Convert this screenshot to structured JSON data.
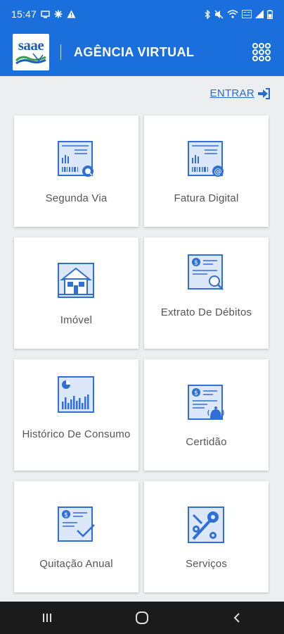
{
  "status_bar": {
    "time": "15:47"
  },
  "header": {
    "logo_text": "saae",
    "title": "AGÊNCIA VIRTUAL",
    "menu_icon": "apps-grid-icon"
  },
  "login": {
    "label": "ENTRAR",
    "icon": "login-arrow-icon"
  },
  "tiles": [
    {
      "label": "Segunda Via",
      "icon": "bill-barcode-icon"
    },
    {
      "label": "Fatura Digital",
      "icon": "digital-invoice-icon"
    },
    {
      "label": "Imóvel",
      "icon": "house-icon"
    },
    {
      "label": "Extrato De Débitos",
      "icon": "debt-statement-icon"
    },
    {
      "label": "Histórico De Consumo",
      "icon": "consumption-chart-icon"
    },
    {
      "label": "Certidão",
      "icon": "certificate-icon"
    },
    {
      "label": "Quitação Anual",
      "icon": "annual-clearance-icon"
    },
    {
      "label": "Serviços",
      "icon": "services-gears-icon"
    }
  ],
  "colors": {
    "primary": "#1b6fdc",
    "icon_blue": "#2e6fd8",
    "background": "#eceeef"
  }
}
